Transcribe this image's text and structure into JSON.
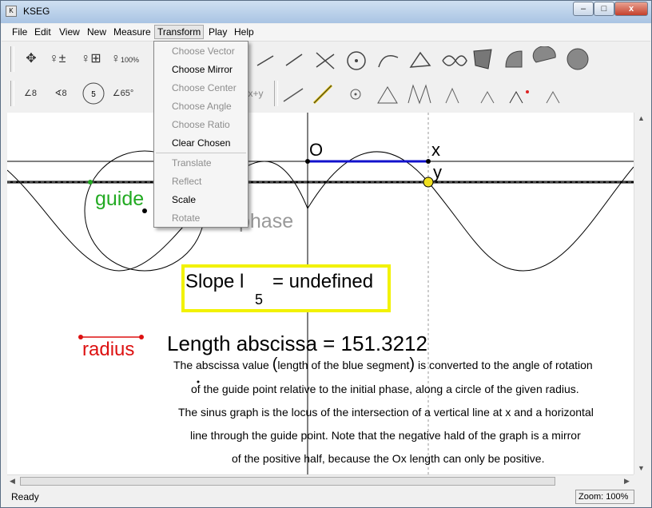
{
  "window": {
    "title": "KSEG",
    "minimize_label": "–",
    "maximize_label": "□",
    "close_label": "x"
  },
  "menu": {
    "file": "File",
    "edit": "Edit",
    "view": "View",
    "new": "New",
    "measure": "Measure",
    "transform": "Transform",
    "play": "Play",
    "help": "Help"
  },
  "transform_menu": {
    "choose_vector": "Choose Vector",
    "choose_mirror": "Choose Mirror",
    "choose_center": "Choose Center",
    "choose_angle": "Choose Angle",
    "choose_ratio": "Choose Ratio",
    "clear_chosen": "Clear Chosen",
    "translate": "Translate",
    "reflect": "Reflect",
    "scale": "Scale",
    "rotate": "Rotate"
  },
  "toolbar": {
    "zoom_100_label": "100%",
    "angle_label": "65°",
    "measure_8_label": "8",
    "count_5_label": "5",
    "sum_label": "x+y"
  },
  "canvas": {
    "label_O": "O",
    "label_x": "x",
    "label_y": "y",
    "label_guide": "guide",
    "label_phase": "phase",
    "label_radius": "radius",
    "slope_text": "Slope l",
    "slope_sub": "5",
    "slope_value": "= undefined",
    "length_text": "Length abscissa = 151.3212",
    "desc_line1_a": "The abscissa value ",
    "desc_line1_paren": "length of the blue segment",
    "desc_line1_b": " is converted to the angle of rotation",
    "desc_line2": "of the guide point relative to the initial phase, along a circle of the given radius.",
    "desc_line3": "The sinus graph is the locus of the intersection of a vertical line at x and a horizontal",
    "desc_line4": "line through the guide point. Note that the negative hald of the graph is a mirror",
    "desc_line5": "of the positive half, because the Ox length can only be positive."
  },
  "status": {
    "text": "Ready",
    "zoom": "Zoom: 100%"
  },
  "colors": {
    "guide": "#22aa22",
    "radius": "#dd1111",
    "slope_box": "#f2f200",
    "segment": "#1111cc"
  }
}
